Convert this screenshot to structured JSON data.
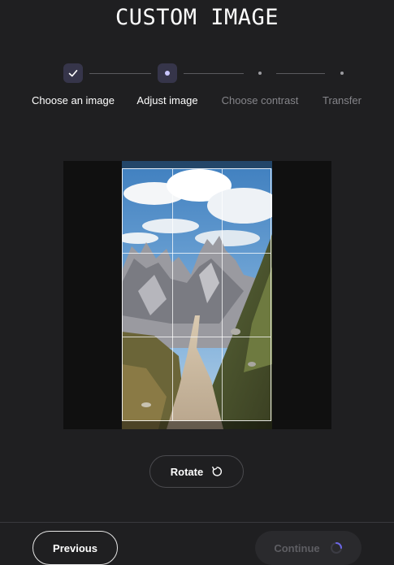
{
  "header": {
    "title": "CUSTOM IMAGE"
  },
  "stepper": {
    "steps": [
      {
        "label": "Choose an image",
        "state": "completed",
        "icon": "check-icon"
      },
      {
        "label": "Adjust image",
        "state": "current",
        "icon": "dot-icon"
      },
      {
        "label": "Choose contrast",
        "state": "upcoming",
        "icon": "dot-icon"
      },
      {
        "label": "Transfer",
        "state": "upcoming",
        "icon": "dot-icon"
      }
    ]
  },
  "editor": {
    "image_subject": "mountain-trail-photo",
    "rotate_label": "Rotate",
    "rotate_icon": "rotate-icon"
  },
  "footer": {
    "previous_label": "Previous",
    "continue_label": "Continue",
    "continue_state": "loading",
    "spinner_icon": "loading-spinner-icon"
  },
  "colors": {
    "background": "#1f1f21",
    "step_marker": "#36354a",
    "accent": "#c9c6ff",
    "spinner": "#6b66e6"
  }
}
